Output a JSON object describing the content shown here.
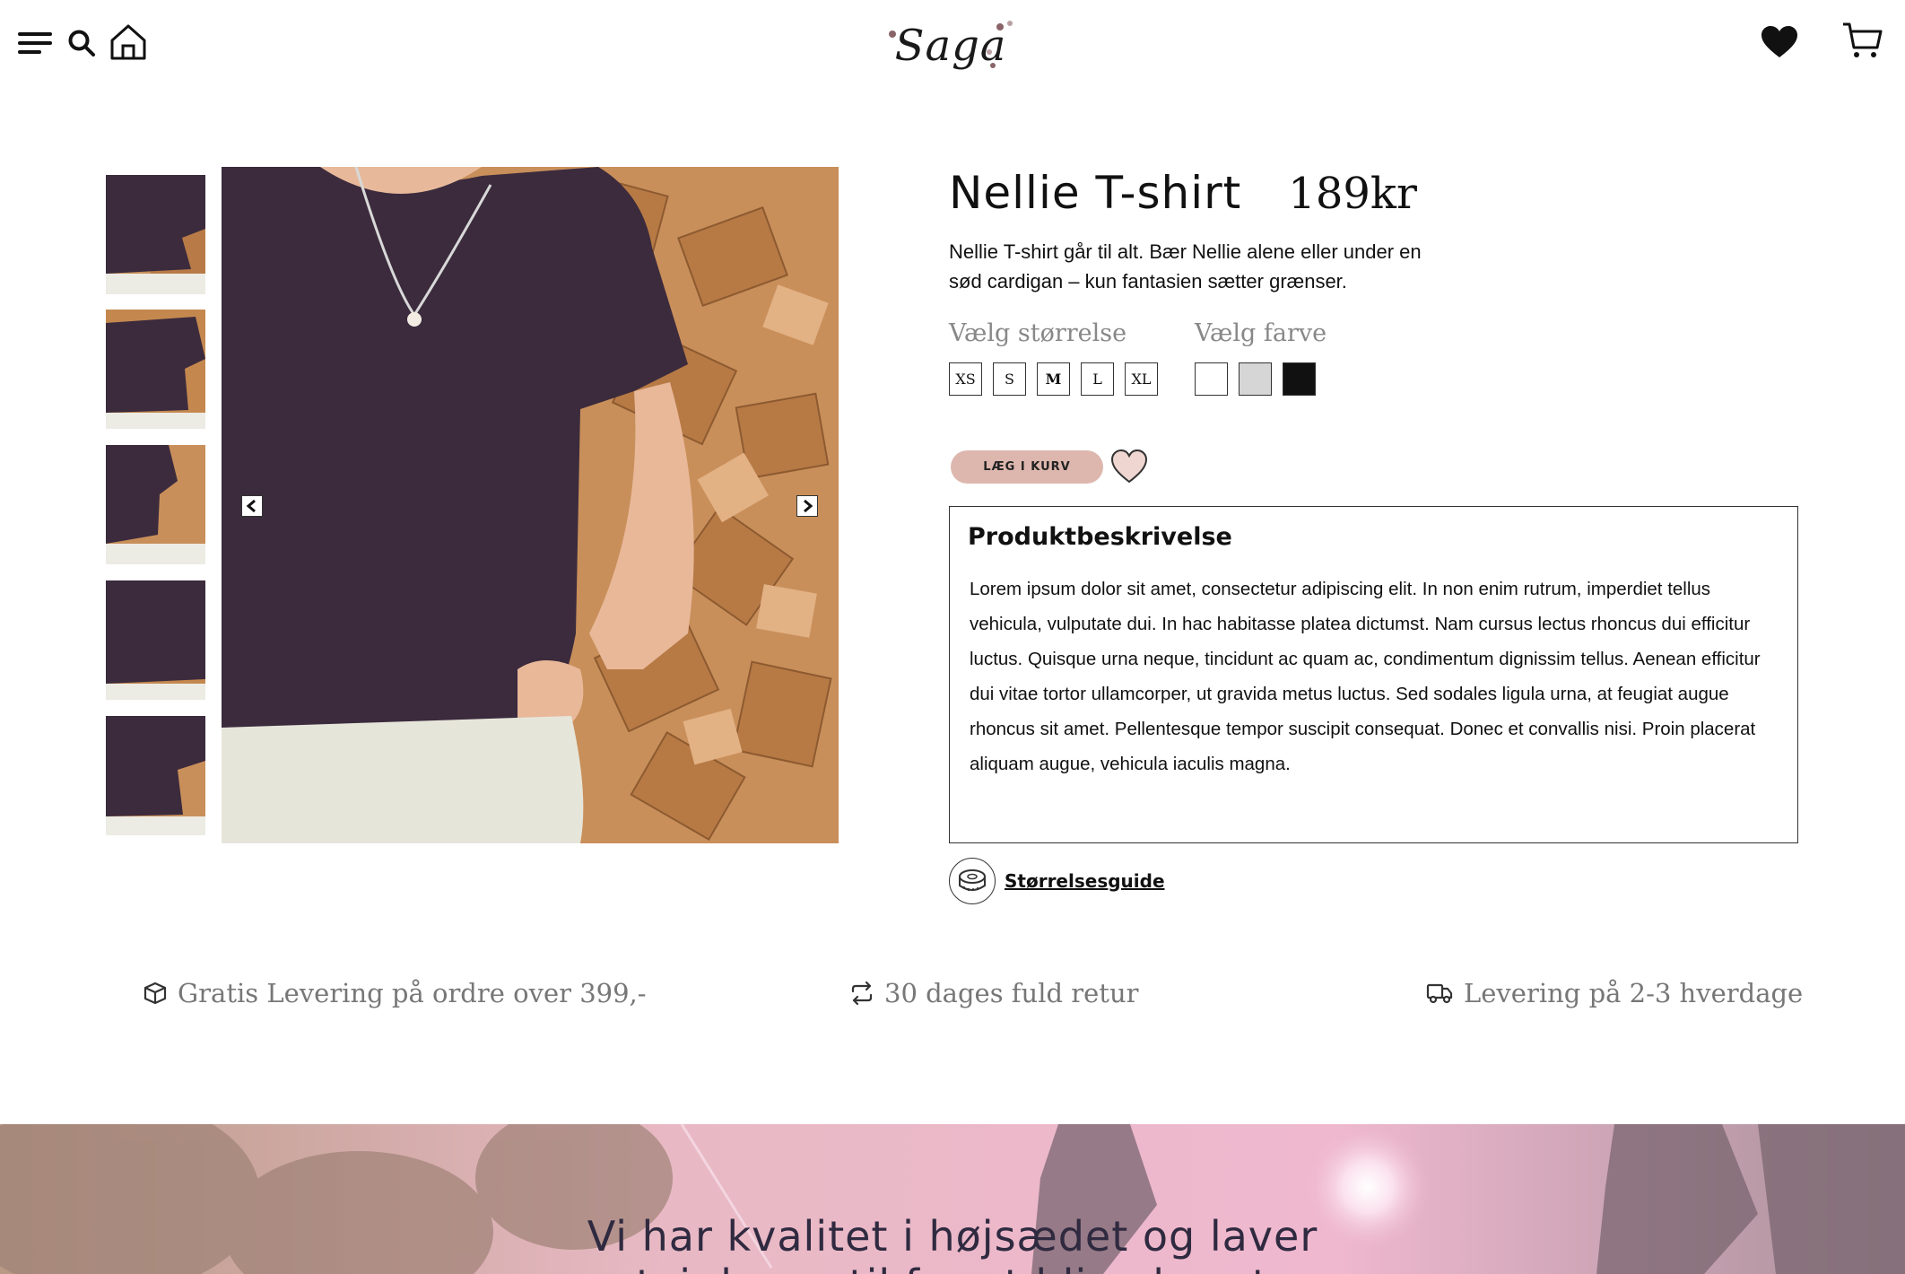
{
  "header": {
    "logo_text": "Saga",
    "icons": [
      "menu-icon",
      "search-icon",
      "home-icon",
      "heart-icon",
      "cart-icon"
    ]
  },
  "product": {
    "title": "Nellie T-shirt",
    "price": "189kr",
    "short_description": "Nellie T-shirt går til alt. Bær Nellie alene eller under en sød cardigan – kun fantasien sætter grænser.",
    "size_label": "Vælg størrelse",
    "sizes": [
      "XS",
      "S",
      "M",
      "L",
      "XL"
    ],
    "selected_size": "M",
    "color_label": "Vælg farve",
    "colors": [
      "#ffffff",
      "#d6d6d6",
      "#111111"
    ],
    "add_to_cart_label": "LÆG I KURV"
  },
  "description_box": {
    "heading": "Produktbeskrivelse",
    "body": "Lorem ipsum dolor sit amet, consectetur adipiscing elit. In non enim rutrum, imperdiet tellus vehicula, vulputate dui. In hac habitasse platea dictumst. Nam cursus lectus rhoncus dui efficitur luctus. Quisque urna neque, tincidunt ac quam ac, condimentum dignissim tellus. Aenean efficitur dui vitae tortor ullamcorper, ut gravida metus luctus. Sed sodales ligula urna, at feugiat augue rhoncus sit amet. Pellentesque tempor suscipit consequat. Donec et convallis nisi. Proin placerat aliquam augue, vehicula iaculis magna."
  },
  "size_guide_label": "Størrelsesguide",
  "benefits": [
    {
      "icon": "box-icon",
      "text": "Gratis Levering på ordre over 399,-"
    },
    {
      "icon": "return-icon",
      "text": "30 dages fuld retur"
    },
    {
      "icon": "truck-icon",
      "text": "Levering på 2-3 hverdage"
    }
  ],
  "banner": {
    "line1": "Vi har kvalitet i højsædet og laver",
    "line2": "tøj der er til for at blive brugt"
  },
  "colors": {
    "cart_button": "#ddb7ae",
    "heart_fill": "#f0d6d0",
    "shirt": "#3b2b3d",
    "wood": "#c98f5a"
  }
}
